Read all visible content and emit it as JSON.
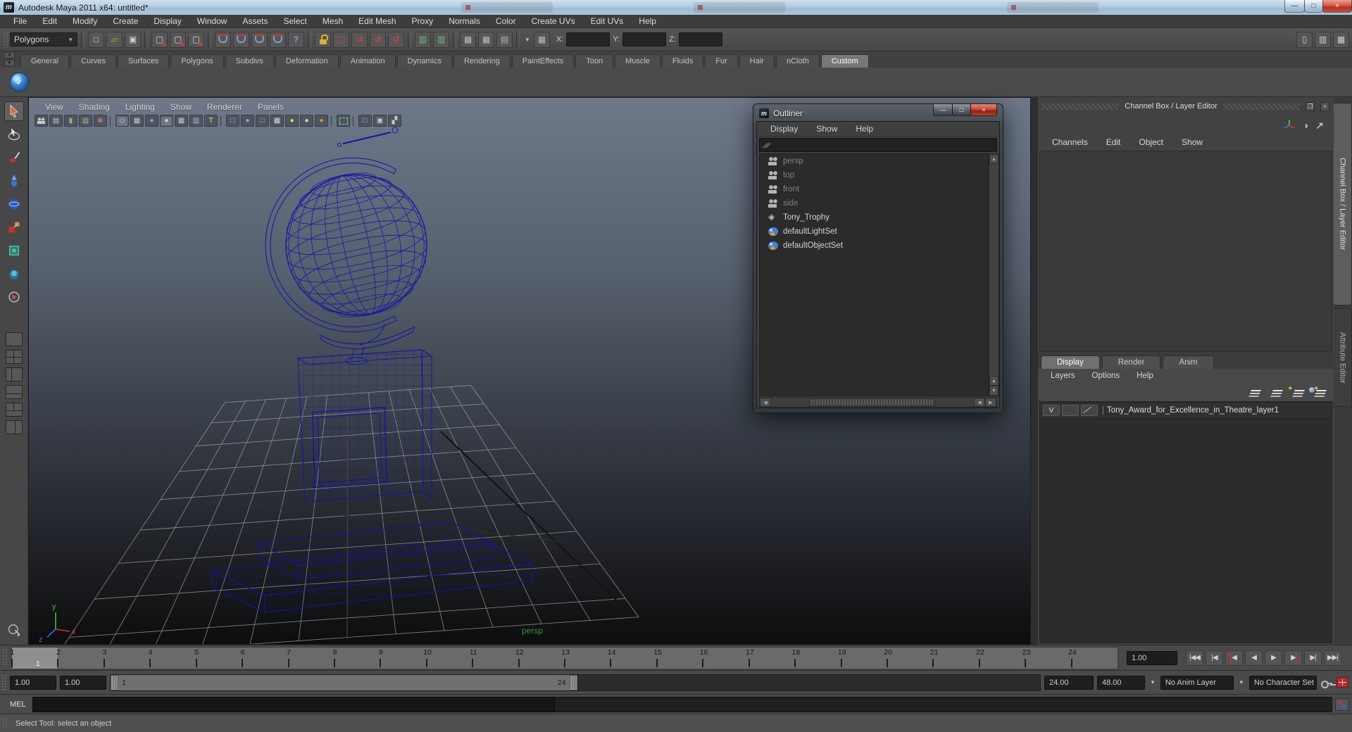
{
  "window": {
    "title": "Autodesk Maya 2011 x64: untitled*",
    "controls": {
      "minimize": "—",
      "maximize": "□",
      "close": "×"
    }
  },
  "menubar": {
    "items": [
      "File",
      "Edit",
      "Modify",
      "Create",
      "Display",
      "Window",
      "Assets",
      "Select",
      "Mesh",
      "Edit Mesh",
      "Proxy",
      "Normals",
      "Color",
      "Create UVs",
      "Edit UVs",
      "Help"
    ]
  },
  "toolbar": {
    "mode_selector": "Polygons",
    "coord_labels": {
      "x": "X:",
      "y": "Y:",
      "z": "Z:"
    },
    "coord_values": {
      "x": "",
      "y": "",
      "z": ""
    },
    "icons": [
      "new-scene",
      "open-scene",
      "save-scene",
      "select-by-hierarchy",
      "select-by-object",
      "select-by-component",
      "snap-to-grid",
      "snap-to-curve",
      "snap-to-point",
      "snap-to-view-plane",
      "make-object-live",
      "quick-help",
      "lock-selection",
      "highlight-selection",
      "construction-history",
      "render-current-frame",
      "ipr-render",
      "render-settings",
      "pipeline-a",
      "pipeline-b",
      "input-table",
      "output-table",
      "counter",
      "show-single-pane",
      "show-split-pane",
      "show-grid-pane"
    ]
  },
  "shelf": {
    "tabs": [
      {
        "label": "General"
      },
      {
        "label": "Curves"
      },
      {
        "label": "Surfaces"
      },
      {
        "label": "Polygons"
      },
      {
        "label": "Subdivs"
      },
      {
        "label": "Deformation"
      },
      {
        "label": "Animation"
      },
      {
        "label": "Dynamics"
      },
      {
        "label": "Rendering"
      },
      {
        "label": "PaintEffects"
      },
      {
        "label": "Toon"
      },
      {
        "label": "Muscle"
      },
      {
        "label": "Fluids"
      },
      {
        "label": "Fur"
      },
      {
        "label": "Hair"
      },
      {
        "label": "nCloth"
      },
      {
        "label": "Custom",
        "cls": "selected"
      }
    ],
    "icons": [
      "custom-shelf-sphere"
    ]
  },
  "toolbox": {
    "tools": [
      "select-tool",
      "lasso-tool",
      "paint-select-tool",
      "move-tool",
      "rotate-tool",
      "scale-tool",
      "universal-manipulator-tool",
      "soft-mod-tool",
      "last-tool"
    ],
    "layouts": [
      "single-pane-layout",
      "four-pane-layout",
      "left-split-layout",
      "bottom-split-layout",
      "top-split-layout",
      "side-split-layout"
    ],
    "bottom": [
      "isolate-select"
    ]
  },
  "viewport": {
    "menus": [
      "View",
      "Shading",
      "Lighting",
      "Show",
      "Renderer",
      "Panels"
    ],
    "icons": [
      "select-camera",
      "camera-attributes",
      "bookmark",
      "image-plane",
      "zoom-region",
      "grid",
      "film-gate",
      "resolution-gate",
      "gate-mask",
      "field-chart",
      "safe-action",
      "safe-title",
      "wireframe-mode",
      "shaded-mode",
      "smooth-shade",
      "textured",
      "use-all-lights",
      "default-light",
      "no-lights",
      "select-region",
      "low-quality",
      "high-quality",
      "share-view"
    ],
    "camera_label": "persp",
    "axis": {
      "x": "x",
      "y": "y",
      "z": "z"
    }
  },
  "outliner": {
    "title": "Outliner",
    "controls": {
      "minimize": "—",
      "maximize": "□",
      "close": "×"
    },
    "menus": [
      "Display",
      "Show",
      "Help"
    ],
    "search_value": "",
    "items": [
      {
        "label": "persp",
        "icon": "camera",
        "muted": true
      },
      {
        "label": "top",
        "icon": "camera",
        "muted": true
      },
      {
        "label": "front",
        "icon": "camera",
        "muted": true
      },
      {
        "label": "side",
        "icon": "camera",
        "muted": true
      },
      {
        "label": "Tony_Trophy",
        "icon": "mesh",
        "muted": false
      },
      {
        "label": "defaultLightSet",
        "icon": "set",
        "muted": false
      },
      {
        "label": "defaultObjectSet",
        "icon": "set",
        "muted": false
      }
    ]
  },
  "channel_box": {
    "header": "Channel Box / Layer Editor",
    "window_icons": [
      "float-panel",
      "close-panel"
    ],
    "icons": [
      "channel-manipulator-axis",
      "channel-speed-toggle",
      "channel-hyperbolic-arrow"
    ],
    "menus": [
      "Channels",
      "Edit",
      "Object",
      "Show"
    ],
    "side_tabs": [
      "Channel Box / Layer Editor",
      "Attribute Editor"
    ]
  },
  "layer_editor": {
    "tabs": [
      {
        "label": "Display",
        "cls": "selected"
      },
      {
        "label": "Render"
      },
      {
        "label": "Anim"
      }
    ],
    "menus": [
      "Layers",
      "Options",
      "Help"
    ],
    "icons": [
      "move-layer-up",
      "move-layer-down",
      "create-empty-layer",
      "create-layer-from-selected"
    ],
    "layers": [
      {
        "visibility": "V",
        "name": "Tony_Award_for_Excellence_in_Theatre_layer1"
      }
    ]
  },
  "timeline": {
    "frames": [
      "1",
      "2",
      "3",
      "4",
      "5",
      "6",
      "7",
      "8",
      "9",
      "10",
      "11",
      "12",
      "13",
      "14",
      "15",
      "16",
      "17",
      "18",
      "19",
      "20",
      "21",
      "22",
      "23",
      "24"
    ],
    "current_frame": "1",
    "current_time_field": "1.00",
    "playback_glyphs": [
      "|◀◀",
      "|◀",
      "◀",
      "◀",
      "▶",
      "▶",
      "▶|",
      "▶▶|"
    ],
    "playback_names": [
      "go-to-start",
      "step-back-frame",
      "step-back-key",
      "play-backwards",
      "play-forwards",
      "step-forward-key",
      "step-forward-frame",
      "go-to-end"
    ]
  },
  "range_slider": {
    "playback_start": "1.00",
    "anim_start": "1.00",
    "range_start_label": "1",
    "range_end_label": "24",
    "playback_end": "24.00",
    "anim_end": "48.00",
    "anim_layer": "No Anim Layer",
    "character_set": "No Character Set",
    "icons": [
      "auto-keyframe",
      "animation-preferences"
    ]
  },
  "command_line": {
    "label": "MEL",
    "input_value": "",
    "icons": [
      "script-editor"
    ]
  },
  "help_line": {
    "text": "Select Tool: select an object"
  },
  "colors": {
    "wireframe_navy": "#1414a6",
    "viewport_top": "#6e7889",
    "viewport_bottom": "#0d0d0d",
    "grid_line": "#a9a9a9",
    "close_button_red": "#c2392f",
    "persp_label_green": "#3f8f3f",
    "axis_x_red": "#cc3333",
    "axis_y_green": "#3fbf3f",
    "axis_z_blue": "#4466ee"
  }
}
